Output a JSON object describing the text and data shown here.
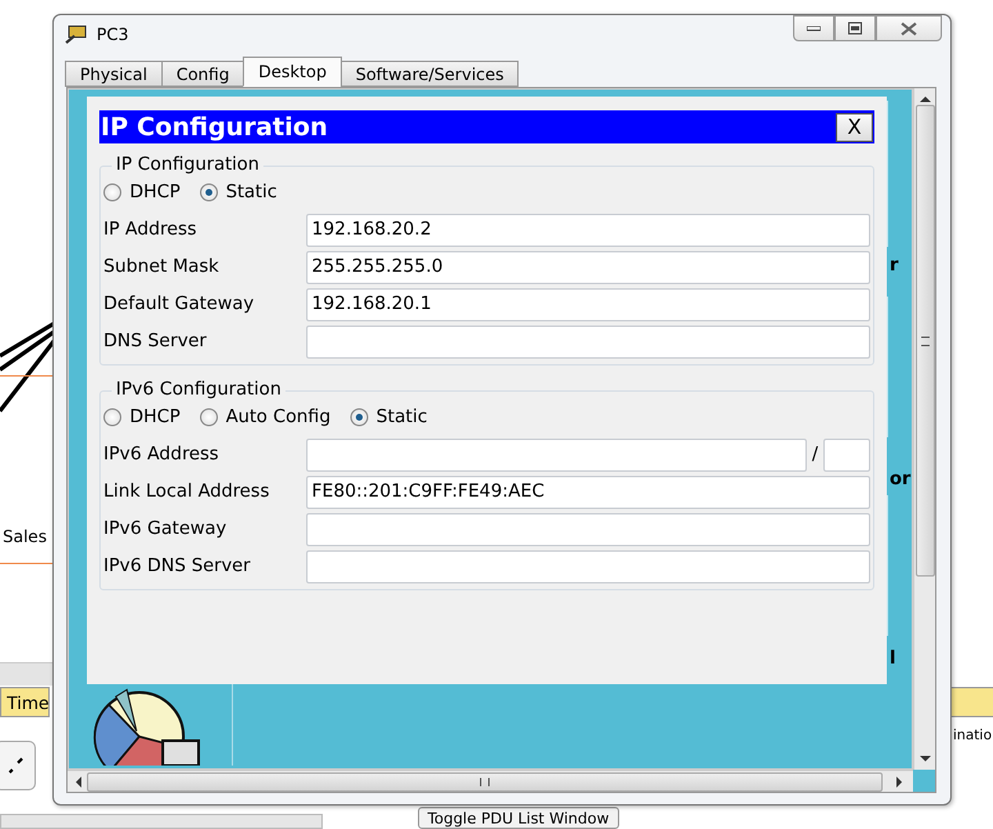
{
  "window": {
    "title": "PC3"
  },
  "tabs": [
    {
      "label": "Physical",
      "selected": false
    },
    {
      "label": "Config",
      "selected": false
    },
    {
      "label": "Desktop",
      "selected": true
    },
    {
      "label": "Software/Services",
      "selected": false
    }
  ],
  "dialog": {
    "title": "IP Configuration",
    "close": "X",
    "groups": [
      {
        "legend": "IP Configuration",
        "modes": [
          {
            "label": "DHCP",
            "selected": false
          },
          {
            "label": "Static",
            "selected": true
          }
        ],
        "fields": [
          {
            "kind": "plain",
            "label": "IP Address",
            "value": "192.168.20.2"
          },
          {
            "kind": "plain",
            "label": "Subnet Mask",
            "value": "255.255.255.0"
          },
          {
            "kind": "plain",
            "label": "Default Gateway",
            "value": "192.168.20.1"
          },
          {
            "kind": "plain",
            "label": "DNS Server"
          }
        ]
      },
      {
        "legend": "IPv6 Configuration",
        "modes": [
          {
            "label": "DHCP",
            "selected": false
          },
          {
            "label": "Auto Config",
            "selected": false
          },
          {
            "label": "Static",
            "selected": true
          }
        ],
        "fields": [
          {
            "kind": "prefix",
            "label": "IPv6 Address",
            "separator": "/"
          },
          {
            "kind": "plain",
            "label": "Link Local Address",
            "value": "FE80::201:C9FF:FE49:AEC"
          },
          {
            "kind": "plain",
            "label": "IPv6 Gateway"
          },
          {
            "kind": "plain",
            "label": "IPv6 DNS Server"
          }
        ]
      }
    ]
  },
  "desktop_fragments": [
    "r",
    "or",
    "l"
  ],
  "background": {
    "device_label": "Sales",
    "time_label": "Time",
    "cut_label": "inatio",
    "toggle_button": "Toggle PDU List Window"
  }
}
